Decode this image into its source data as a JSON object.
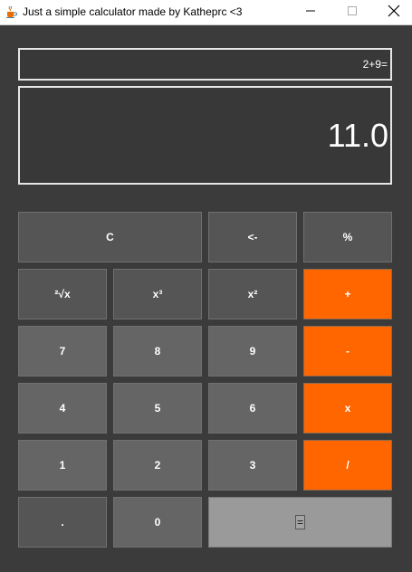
{
  "window": {
    "title": "Just a simple calculator made by Katheprc <3",
    "app_icon": "java-cup-icon",
    "controls": [
      "minimize-icon",
      "maximize-icon",
      "close-icon"
    ]
  },
  "display": {
    "expression": "2+9=",
    "result": "11.0"
  },
  "buttons": {
    "clear": "C",
    "backspace": "<-",
    "percent": "%",
    "sqrt": "²√x",
    "cube": "x³",
    "square": "x²",
    "plus": "+",
    "n7": "7",
    "n8": "8",
    "n9": "9",
    "minus": "-",
    "n4": "4",
    "n5": "5",
    "n6": "6",
    "multiply": "x",
    "n1": "1",
    "n2": "2",
    "n3": "3",
    "divide": "/",
    "dot": ".",
    "n0": "0",
    "equals": "="
  },
  "colors": {
    "background": "#3b3b3b",
    "operator": "#ff6600",
    "number": "#656565",
    "function": "#555555",
    "equals": "#9a9a9a"
  }
}
